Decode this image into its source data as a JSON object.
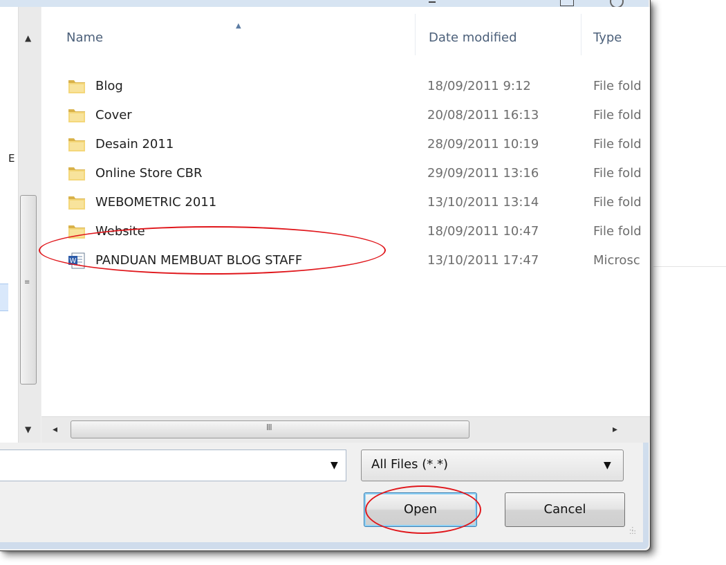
{
  "list": {
    "columns": {
      "name": "Name",
      "date": "Date modified",
      "type": "Type"
    },
    "rows": [
      {
        "name": "Blog",
        "date": "18/09/2011 9:12",
        "type": "File fold",
        "icon": "folder-icon"
      },
      {
        "name": "Cover",
        "date": "20/08/2011 16:13",
        "type": "File fold",
        "icon": "folder-icon"
      },
      {
        "name": "Desain 2011",
        "date": "28/09/2011 10:19",
        "type": "File fold",
        "icon": "folder-icon"
      },
      {
        "name": "Online Store CBR",
        "date": "29/09/2011 13:16",
        "type": "File fold",
        "icon": "folder-icon"
      },
      {
        "name": "WEBOMETRIC 2011",
        "date": "13/10/2011 13:14",
        "type": "File fold",
        "icon": "folder-icon"
      },
      {
        "name": "Website",
        "date": "18/09/2011 10:47",
        "type": "File fold",
        "icon": "folder-icon"
      },
      {
        "name": "PANDUAN MEMBUAT BLOG STAFF",
        "date": "13/10/2011 17:47",
        "type": "Microsc",
        "icon": "word-document-icon"
      }
    ]
  },
  "nav": {
    "clipped_letter": "E"
  },
  "scroll": {
    "h_grip": "III",
    "v_grip": "≡"
  },
  "filter": {
    "selected": "All Files (*.*)"
  },
  "buttons": {
    "open": "Open",
    "cancel": "Cancel"
  },
  "colors": {
    "annotation": "#e0161b",
    "header_text": "#4c607a",
    "secondary_text": "#6d6d6d"
  }
}
